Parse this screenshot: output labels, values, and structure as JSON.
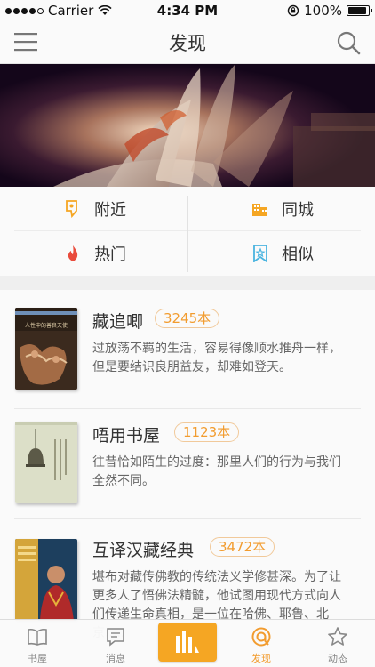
{
  "status_bar": {
    "carrier": "Carrier",
    "time": "4:34 PM",
    "battery": "100%",
    "battery_level": 1.0,
    "signal_bars": 4
  },
  "nav_bar": {
    "title": "发现",
    "left_icon": "menu-icon",
    "right_icon": "search-icon"
  },
  "categories": [
    {
      "label": "附近",
      "icon": "location-pin-icon",
      "color": "#f5a623"
    },
    {
      "label": "同城",
      "icon": "city-building-icon",
      "color": "#f5a623"
    },
    {
      "label": "热门",
      "icon": "fire-icon",
      "color": "#e94b3c"
    },
    {
      "label": "相似",
      "icon": "similar-bookmark-icon",
      "color": "#4ab4e0"
    }
  ],
  "books": [
    {
      "name": "藏追唧",
      "count": "3245本",
      "description": "过放荡不羁的生活，容易得像顺水推舟一样，但是要结识良朋益友，却难如登天。",
      "cover_text": "人性中的善良天使"
    },
    {
      "name": "唔用书屋",
      "count": "1123本",
      "description": "往昔恰如陌生的过度：那里人们的行为与我们全然不同。"
    },
    {
      "name": "互译汉藏经典",
      "count": "3472本",
      "description": "堪布对藏传佛教的传统法义学修甚深。为了让更多人了悟佛法精髓，他试图用现代方式向人们传递生命真相，是一位在哈佛、耶鲁、北京....."
    }
  ],
  "tab_bar": {
    "tabs": [
      {
        "label": "书屋",
        "icon": "book-icon"
      },
      {
        "label": "消息",
        "icon": "message-icon"
      },
      {
        "label": "",
        "icon": "chart-bars-icon"
      },
      {
        "label": "发现",
        "icon": "discover-icon",
        "active": true
      },
      {
        "label": "动态",
        "icon": "star-icon"
      }
    ],
    "accent_color": "#f29c2f"
  }
}
